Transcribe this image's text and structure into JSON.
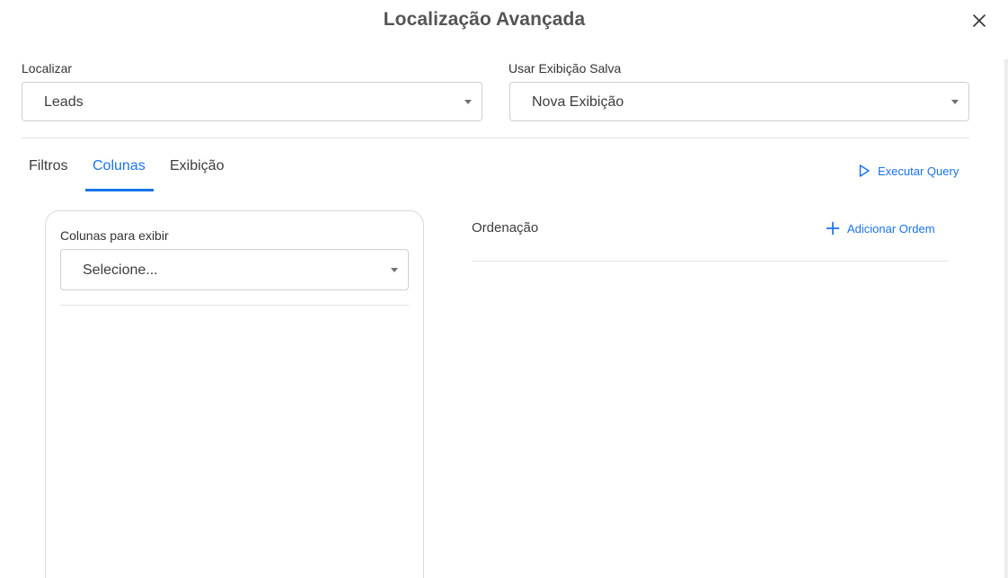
{
  "dialog": {
    "title": "Localização Avançada",
    "close_icon": "close-icon"
  },
  "find": {
    "label": "Localizar",
    "value": "Leads"
  },
  "saved_view": {
    "label": "Usar Exibição Salva",
    "value": "Nova Exibição"
  },
  "tabs": [
    {
      "label": "Filtros",
      "active": false
    },
    {
      "label": "Colunas",
      "active": true
    },
    {
      "label": "Exibição",
      "active": false
    }
  ],
  "run_query": {
    "label": "Executar Query",
    "icon": "play-outline-icon"
  },
  "columns_panel": {
    "label": "Colunas para exibir",
    "placeholder": "Selecione..."
  },
  "ordering": {
    "label": "Ordenação",
    "add_label": "Adicionar Ordem",
    "add_icon": "plus-icon"
  },
  "colors": {
    "accent": "#1a73e8",
    "text": "#3c3c3c",
    "border": "#cfcfcf",
    "divider": "#e3e3e3"
  }
}
